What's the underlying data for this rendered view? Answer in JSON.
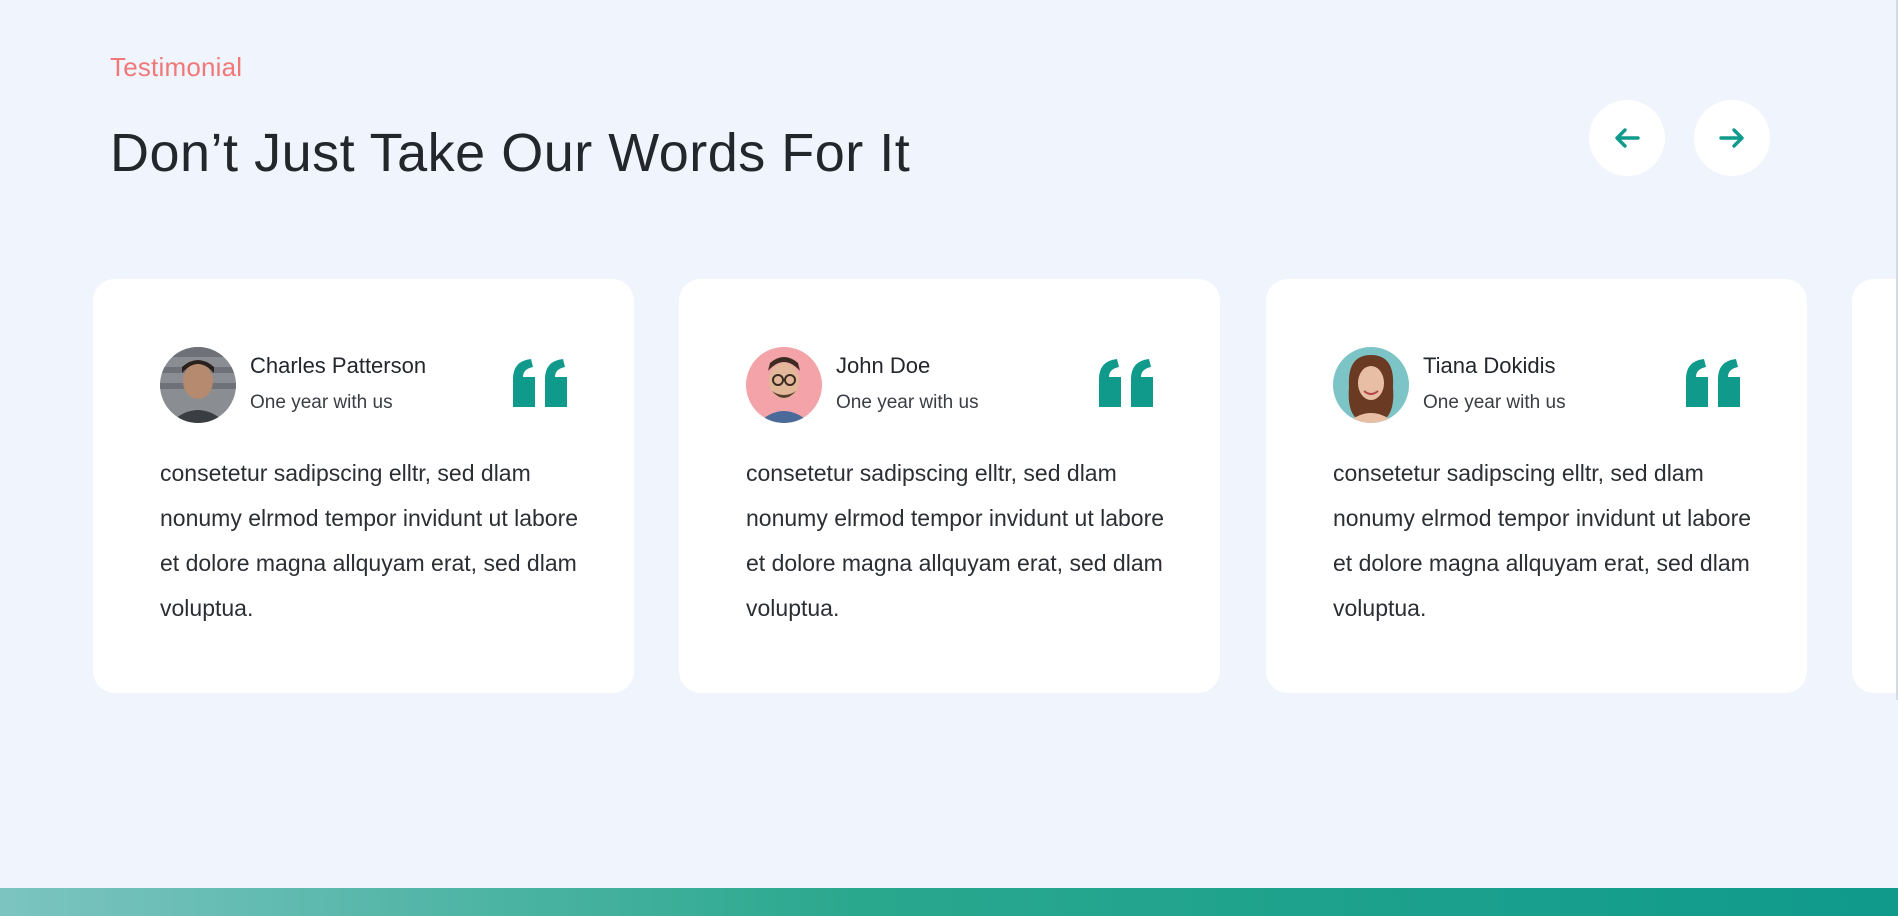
{
  "section": {
    "eyebrow": "Testimonial",
    "title": "Don’t Just Take Our Words For It"
  },
  "nav": {
    "prev_icon": "arrow-left-icon",
    "next_icon": "arrow-right-icon"
  },
  "colors": {
    "accent": "#0f9a8c",
    "eyebrow": "#f07878",
    "background": "#f0f4fc",
    "card": "#ffffff"
  },
  "testimonials": [
    {
      "name": "Charles Patterson",
      "tenure": "One year with us",
      "text": "consetetur sadipscing elltr, sed dlam nonumy elrmod tempor invidunt ut labore et dolore magna allquyam erat, sed dlam voluptua.",
      "avatar_icon": "avatar-charles",
      "quote_icon": "quote-icon"
    },
    {
      "name": "John Doe",
      "tenure": "One year with us",
      "text": "consetetur sadipscing elltr, sed dlam nonumy elrmod tempor invidunt ut labore et dolore magna allquyam erat, sed dlam voluptua.",
      "avatar_icon": "avatar-john",
      "quote_icon": "quote-icon"
    },
    {
      "name": "Tiana Dokidis",
      "tenure": "One year with us",
      "text": "consetetur sadipscing elltr, sed dlam nonumy elrmod tempor invidunt ut labore et dolore magna allquyam erat, sed dlam voluptua.",
      "avatar_icon": "avatar-tiana",
      "quote_icon": "quote-icon"
    }
  ]
}
